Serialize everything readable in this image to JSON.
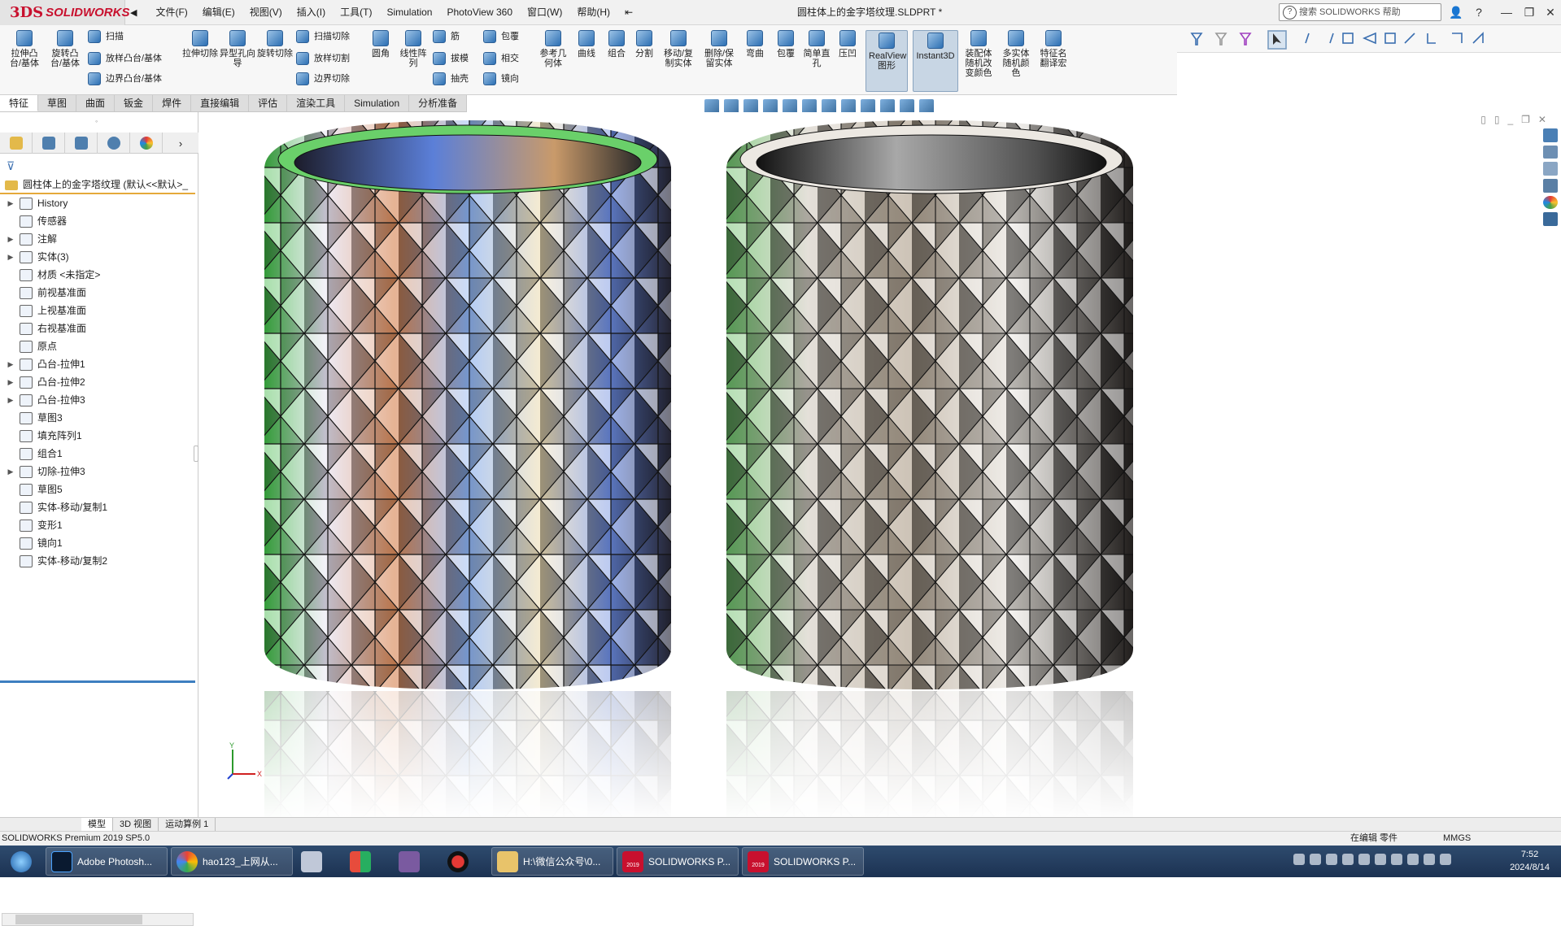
{
  "app": {
    "logo_prefix": "3DS",
    "logo_text": "SOLIDWORKS",
    "document_title": "圆柱体上的金字塔纹理.SLDPRT *"
  },
  "menu": [
    "文件(F)",
    "编辑(E)",
    "视图(V)",
    "插入(I)",
    "工具(T)",
    "Simulation",
    "PhotoView 360",
    "窗口(W)",
    "帮助(H)"
  ],
  "search": {
    "placeholder": "搜索 SOLIDWORKS 帮助"
  },
  "commands": {
    "extrude_boss": "拉伸凸台/基体",
    "revolve_boss": "旋转凸台/基体",
    "sweep": "扫描",
    "loft": "放样凸台/基体",
    "boundary": "边界凸台/基体",
    "extrude_cut": "拉伸切除",
    "hole_wizard": "异型孔向导",
    "revolve_cut": "旋转切除",
    "swept_cut": "扫描切除",
    "lofted_cut": "放样切割",
    "boundary_cut": "边界切除",
    "fillet": "圆角",
    "linear_pattern": "线性阵列",
    "rib": "筋",
    "draft": "拔模",
    "shell": "抽壳",
    "wrap": "包覆",
    "intersect": "相交",
    "mirror": "镜向",
    "ref_geometry": "参考几何体",
    "curves": "曲线",
    "combine": "组合",
    "split": "分割",
    "move_copy": "移动/复制实体",
    "delete_keep": "删除/保留实体",
    "flex": "弯曲",
    "wrap2": "包覆",
    "simple_hole": "简单直孔",
    "indent": "压凹",
    "realview": "RealView图形",
    "instant3d": "Instant3D",
    "assembly_color": "装配体随机改变颜色",
    "multibody_color": "多实体随机颜色",
    "feature_rename": "特征名翻译宏"
  },
  "tabs": [
    "特征",
    "草图",
    "曲面",
    "钣金",
    "焊件",
    "直接编辑",
    "评估",
    "渲染工具",
    "Simulation",
    "分析准备"
  ],
  "tree": {
    "root": "圆柱体上的金字塔纹理  (默认<<默认>_",
    "items": [
      {
        "label": "History",
        "arrow": "▶"
      },
      {
        "label": "传感器",
        "arrow": ""
      },
      {
        "label": "注解",
        "arrow": "▶"
      },
      {
        "label": "实体(3)",
        "arrow": "▶"
      },
      {
        "label": "材质 <未指定>",
        "arrow": ""
      },
      {
        "label": "前视基准面",
        "arrow": ""
      },
      {
        "label": "上视基准面",
        "arrow": ""
      },
      {
        "label": "右视基准面",
        "arrow": ""
      },
      {
        "label": "原点",
        "arrow": ""
      },
      {
        "label": "凸台-拉伸1",
        "arrow": "▶"
      },
      {
        "label": "凸台-拉伸2",
        "arrow": "▶"
      },
      {
        "label": "凸台-拉伸3",
        "arrow": "▶"
      },
      {
        "label": "草图3",
        "arrow": ""
      },
      {
        "label": "填充阵列1",
        "arrow": ""
      },
      {
        "label": "组合1",
        "arrow": ""
      },
      {
        "label": "切除-拉伸3",
        "arrow": "▶"
      },
      {
        "label": "草图5",
        "arrow": ""
      },
      {
        "label": "实体-移动/复制1",
        "arrow": ""
      },
      {
        "label": "变形1",
        "arrow": ""
      },
      {
        "label": "镜向1",
        "arrow": ""
      },
      {
        "label": "实体-移动/复制2",
        "arrow": ""
      }
    ]
  },
  "bottom_tabs": [
    "模型",
    "3D 视图",
    "运动算例 1"
  ],
  "status": {
    "left": "SOLIDWORKS Premium 2019 SP5.0",
    "mode": "在编辑 零件",
    "units": "MMGS"
  },
  "taskbar": {
    "items": [
      "Adobe Photosh...",
      "hao123_上网从...",
      "H:\\微信公众号\\0...",
      "SOLIDWORKS P...",
      "SOLIDWORKS P..."
    ],
    "badge": "2019",
    "time": "7:52",
    "date": "2024/8/14"
  },
  "triad": {
    "x": "X",
    "y": "Y"
  },
  "colors": {
    "accent": "#c8102e",
    "tree_highlight": "#e5a93a",
    "taskbar": "#1c3252"
  }
}
